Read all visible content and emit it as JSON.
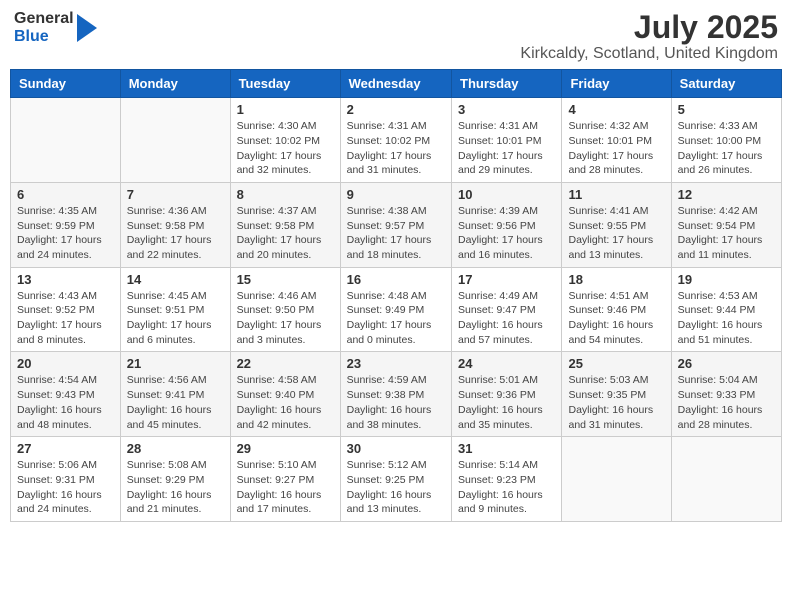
{
  "header": {
    "logo_general": "General",
    "logo_blue": "Blue",
    "month_title": "July 2025",
    "location": "Kirkcaldy, Scotland, United Kingdom"
  },
  "days_of_week": [
    "Sunday",
    "Monday",
    "Tuesday",
    "Wednesday",
    "Thursday",
    "Friday",
    "Saturday"
  ],
  "weeks": [
    [
      {
        "day": "",
        "info": ""
      },
      {
        "day": "",
        "info": ""
      },
      {
        "day": "1",
        "info": "Sunrise: 4:30 AM\nSunset: 10:02 PM\nDaylight: 17 hours and 32 minutes."
      },
      {
        "day": "2",
        "info": "Sunrise: 4:31 AM\nSunset: 10:02 PM\nDaylight: 17 hours and 31 minutes."
      },
      {
        "day": "3",
        "info": "Sunrise: 4:31 AM\nSunset: 10:01 PM\nDaylight: 17 hours and 29 minutes."
      },
      {
        "day": "4",
        "info": "Sunrise: 4:32 AM\nSunset: 10:01 PM\nDaylight: 17 hours and 28 minutes."
      },
      {
        "day": "5",
        "info": "Sunrise: 4:33 AM\nSunset: 10:00 PM\nDaylight: 17 hours and 26 minutes."
      }
    ],
    [
      {
        "day": "6",
        "info": "Sunrise: 4:35 AM\nSunset: 9:59 PM\nDaylight: 17 hours and 24 minutes."
      },
      {
        "day": "7",
        "info": "Sunrise: 4:36 AM\nSunset: 9:58 PM\nDaylight: 17 hours and 22 minutes."
      },
      {
        "day": "8",
        "info": "Sunrise: 4:37 AM\nSunset: 9:58 PM\nDaylight: 17 hours and 20 minutes."
      },
      {
        "day": "9",
        "info": "Sunrise: 4:38 AM\nSunset: 9:57 PM\nDaylight: 17 hours and 18 minutes."
      },
      {
        "day": "10",
        "info": "Sunrise: 4:39 AM\nSunset: 9:56 PM\nDaylight: 17 hours and 16 minutes."
      },
      {
        "day": "11",
        "info": "Sunrise: 4:41 AM\nSunset: 9:55 PM\nDaylight: 17 hours and 13 minutes."
      },
      {
        "day": "12",
        "info": "Sunrise: 4:42 AM\nSunset: 9:54 PM\nDaylight: 17 hours and 11 minutes."
      }
    ],
    [
      {
        "day": "13",
        "info": "Sunrise: 4:43 AM\nSunset: 9:52 PM\nDaylight: 17 hours and 8 minutes."
      },
      {
        "day": "14",
        "info": "Sunrise: 4:45 AM\nSunset: 9:51 PM\nDaylight: 17 hours and 6 minutes."
      },
      {
        "day": "15",
        "info": "Sunrise: 4:46 AM\nSunset: 9:50 PM\nDaylight: 17 hours and 3 minutes."
      },
      {
        "day": "16",
        "info": "Sunrise: 4:48 AM\nSunset: 9:49 PM\nDaylight: 17 hours and 0 minutes."
      },
      {
        "day": "17",
        "info": "Sunrise: 4:49 AM\nSunset: 9:47 PM\nDaylight: 16 hours and 57 minutes."
      },
      {
        "day": "18",
        "info": "Sunrise: 4:51 AM\nSunset: 9:46 PM\nDaylight: 16 hours and 54 minutes."
      },
      {
        "day": "19",
        "info": "Sunrise: 4:53 AM\nSunset: 9:44 PM\nDaylight: 16 hours and 51 minutes."
      }
    ],
    [
      {
        "day": "20",
        "info": "Sunrise: 4:54 AM\nSunset: 9:43 PM\nDaylight: 16 hours and 48 minutes."
      },
      {
        "day": "21",
        "info": "Sunrise: 4:56 AM\nSunset: 9:41 PM\nDaylight: 16 hours and 45 minutes."
      },
      {
        "day": "22",
        "info": "Sunrise: 4:58 AM\nSunset: 9:40 PM\nDaylight: 16 hours and 42 minutes."
      },
      {
        "day": "23",
        "info": "Sunrise: 4:59 AM\nSunset: 9:38 PM\nDaylight: 16 hours and 38 minutes."
      },
      {
        "day": "24",
        "info": "Sunrise: 5:01 AM\nSunset: 9:36 PM\nDaylight: 16 hours and 35 minutes."
      },
      {
        "day": "25",
        "info": "Sunrise: 5:03 AM\nSunset: 9:35 PM\nDaylight: 16 hours and 31 minutes."
      },
      {
        "day": "26",
        "info": "Sunrise: 5:04 AM\nSunset: 9:33 PM\nDaylight: 16 hours and 28 minutes."
      }
    ],
    [
      {
        "day": "27",
        "info": "Sunrise: 5:06 AM\nSunset: 9:31 PM\nDaylight: 16 hours and 24 minutes."
      },
      {
        "day": "28",
        "info": "Sunrise: 5:08 AM\nSunset: 9:29 PM\nDaylight: 16 hours and 21 minutes."
      },
      {
        "day": "29",
        "info": "Sunrise: 5:10 AM\nSunset: 9:27 PM\nDaylight: 16 hours and 17 minutes."
      },
      {
        "day": "30",
        "info": "Sunrise: 5:12 AM\nSunset: 9:25 PM\nDaylight: 16 hours and 13 minutes."
      },
      {
        "day": "31",
        "info": "Sunrise: 5:14 AM\nSunset: 9:23 PM\nDaylight: 16 hours and 9 minutes."
      },
      {
        "day": "",
        "info": ""
      },
      {
        "day": "",
        "info": ""
      }
    ]
  ]
}
